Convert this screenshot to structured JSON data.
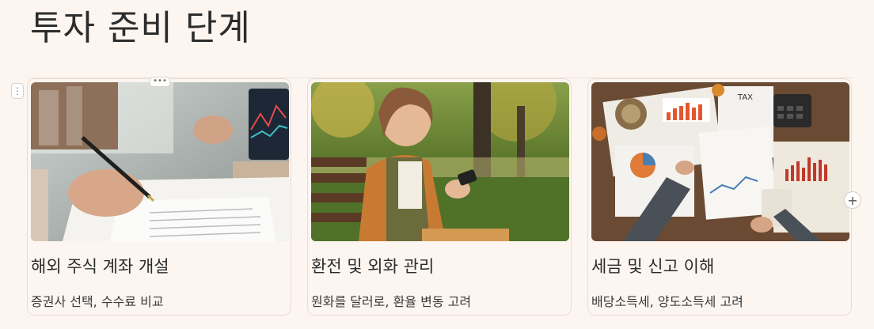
{
  "page": {
    "title": "투자 준비 단계"
  },
  "block_handle": {
    "icon": "vertical-dots-icon",
    "glyph": "⋮"
  },
  "drag_handle": {
    "icon": "horizontal-dots-icon",
    "glyph": "•••"
  },
  "add_column": {
    "icon": "plus-icon",
    "glyph": "+"
  },
  "cards": [
    {
      "title": "해외 주식 계좌 개설",
      "subtitle": "증권사 선택, 수수료 비교",
      "image": "person signing brokerage account form with pen, laptop showing stock chart"
    },
    {
      "title": "환전 및 외화 관리",
      "subtitle": "원화를 달러로, 환율 변동 고려",
      "image": "smiling woman on park bench using smartphone"
    },
    {
      "title": "세금 및 신고 이해",
      "subtitle": "배당소득세, 양도소득세 고려",
      "image": "tax documents, charts, calculator on wooden desk"
    }
  ]
}
